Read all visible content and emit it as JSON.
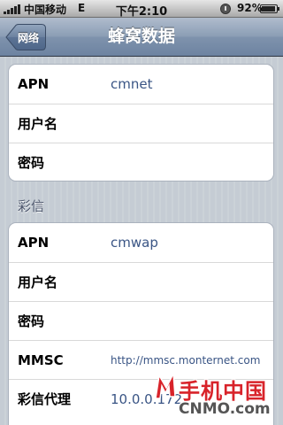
{
  "status_bar": {
    "carrier": "中国移动",
    "network": "E",
    "time": "下午2:10",
    "battery": "92%",
    "battery_level": 0.92
  },
  "nav": {
    "back_label": "网络",
    "title": "蜂窝数据"
  },
  "cellular_data": {
    "rows": [
      {
        "label": "APN",
        "value": "cmnet"
      },
      {
        "label": "用户名",
        "value": ""
      },
      {
        "label": "密码",
        "value": ""
      }
    ]
  },
  "mms": {
    "header": "彩信",
    "rows": [
      {
        "label": "APN",
        "value": "cmwap"
      },
      {
        "label": "用户名",
        "value": ""
      },
      {
        "label": "密码",
        "value": ""
      },
      {
        "label": "MMSC",
        "value": "http://mmsc.monternet.com"
      },
      {
        "label": "彩信代理",
        "value": "10.0.0.172"
      }
    ]
  },
  "watermark": {
    "chinese": "手机中国",
    "english": "CNMO.com"
  }
}
